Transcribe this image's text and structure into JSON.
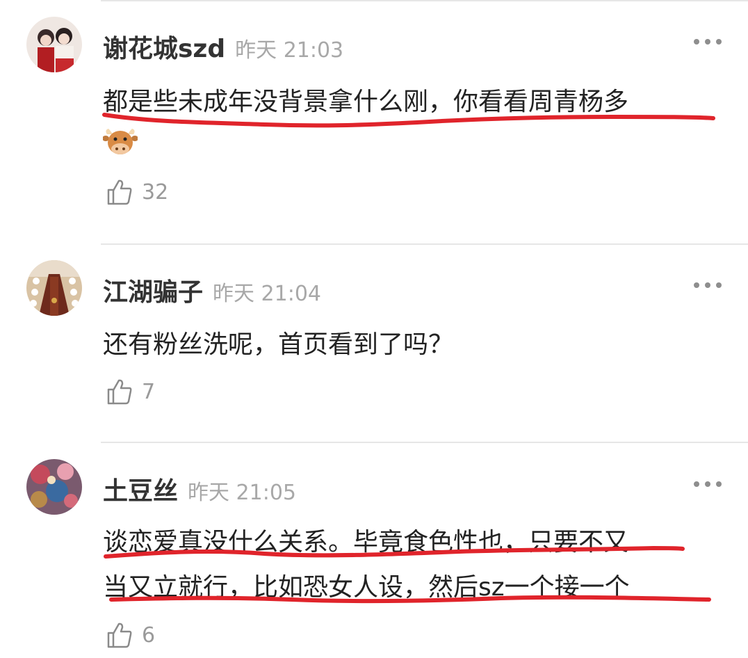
{
  "comments": [
    {
      "username": "谢花城szd",
      "time": "昨天 21:03",
      "text": "都是些未成年没背景拿什么刚，你看看周青杨多",
      "emoji": "cow-face-emoji",
      "likes": "32",
      "avatar": "two-figures-avatar"
    },
    {
      "username": "江湖骗子",
      "time": "昨天 21:04",
      "text": "还有粉丝洗呢，首页看到了吗？",
      "likes": "7",
      "avatar": "banquet-table-avatar"
    },
    {
      "username": "土豆丝",
      "time": "昨天 21:05",
      "text_line1": "谈恋爱真没什么关系。毕竟食色性也，只要不又",
      "text_line2": "当又立就行，比如恐女人设，然后sz一个接一个",
      "likes": "6",
      "avatar": "flowers-painting-avatar"
    }
  ],
  "icons": {
    "like": "thumbs-up-icon",
    "more": "more-dots-icon"
  },
  "colors": {
    "annotation_red": "#e0242b",
    "time_gray": "#a8a8a8"
  }
}
